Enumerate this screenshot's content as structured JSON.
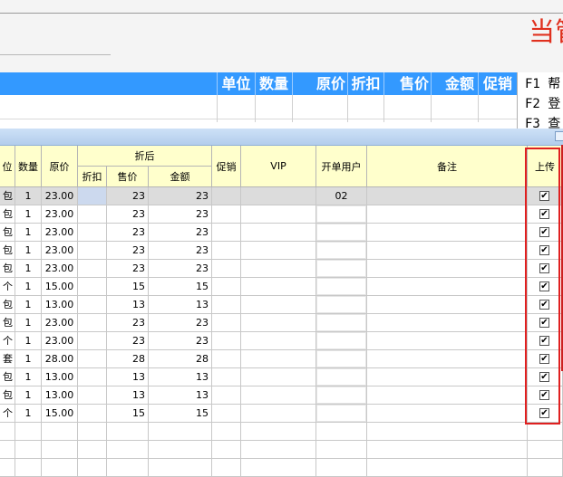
{
  "brand": {
    "text": "当管",
    "color": "#e0301e"
  },
  "entry_table": {
    "columns": [
      "单位",
      "数量",
      "原价",
      "折扣",
      "售价",
      "金额",
      "促销"
    ],
    "header_color": "#3399ff"
  },
  "function_keys": [
    "F1  帮",
    "F2  登",
    "F3  查"
  ],
  "grid": {
    "headers": {
      "unit": "位",
      "qty": "数量",
      "orig_price": "原价",
      "after_discount": "折后",
      "discount": "折扣",
      "sale_price": "售价",
      "amount": "金额",
      "promo": "促销",
      "vip": "VIP",
      "open_user": "开单用户",
      "remark": "备注",
      "upload": "上传"
    },
    "rows": [
      {
        "unit": "包",
        "qty": "1",
        "price": "23.00",
        "discount": "",
        "sale": "23",
        "amount": "23",
        "user": "02",
        "upload": true
      },
      {
        "unit": "包",
        "qty": "1",
        "price": "23.00",
        "discount": "",
        "sale": "23",
        "amount": "23",
        "user": "",
        "upload": true
      },
      {
        "unit": "包",
        "qty": "1",
        "price": "23.00",
        "discount": "",
        "sale": "23",
        "amount": "23",
        "user": "",
        "upload": true
      },
      {
        "unit": "包",
        "qty": "1",
        "price": "23.00",
        "discount": "",
        "sale": "23",
        "amount": "23",
        "user": "",
        "upload": true
      },
      {
        "unit": "包",
        "qty": "1",
        "price": "23.00",
        "discount": "",
        "sale": "23",
        "amount": "23",
        "user": "",
        "upload": true
      },
      {
        "unit": "个",
        "qty": "1",
        "price": "15.00",
        "discount": "",
        "sale": "15",
        "amount": "15",
        "user": "",
        "upload": true
      },
      {
        "unit": "包",
        "qty": "1",
        "price": "13.00",
        "discount": "",
        "sale": "13",
        "amount": "13",
        "user": "",
        "upload": true
      },
      {
        "unit": "包",
        "qty": "1",
        "price": "23.00",
        "discount": "",
        "sale": "23",
        "amount": "23",
        "user": "",
        "upload": true
      },
      {
        "unit": "个",
        "qty": "1",
        "price": "23.00",
        "discount": "",
        "sale": "23",
        "amount": "23",
        "user": "",
        "upload": true
      },
      {
        "unit": "套",
        "qty": "1",
        "price": "28.00",
        "discount": "",
        "sale": "28",
        "amount": "28",
        "user": "",
        "upload": true
      },
      {
        "unit": "包",
        "qty": "1",
        "price": "13.00",
        "discount": "",
        "sale": "13",
        "amount": "13",
        "user": "",
        "upload": true
      },
      {
        "unit": "包",
        "qty": "1",
        "price": "13.00",
        "discount": "",
        "sale": "13",
        "amount": "13",
        "user": "",
        "upload": true
      },
      {
        "unit": "个",
        "qty": "1",
        "price": "15.00",
        "discount": "",
        "sale": "15",
        "amount": "15",
        "user": "",
        "upload": true
      }
    ],
    "check_mark": "✔",
    "highlight_color": "#e02020",
    "header_bg": "#ffffcc"
  }
}
